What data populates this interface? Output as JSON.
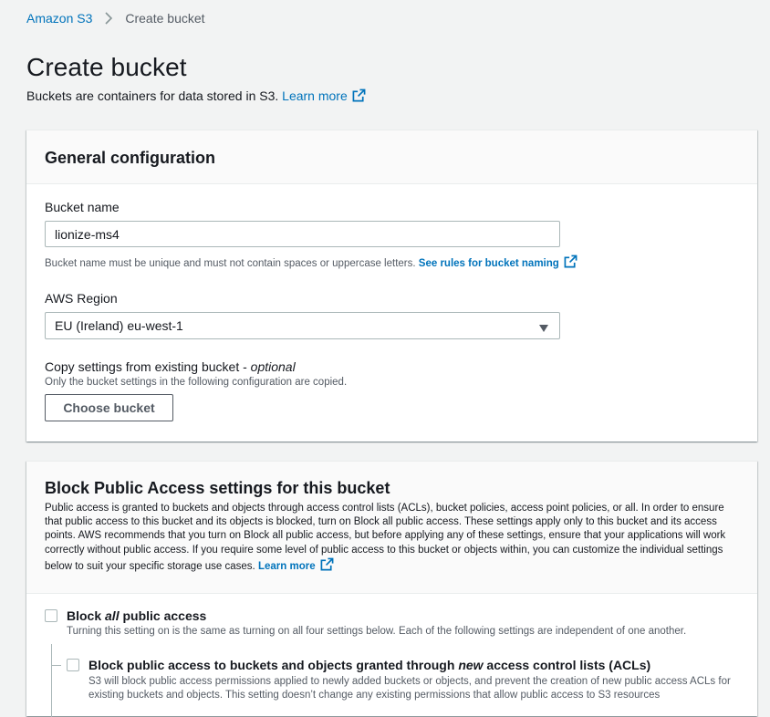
{
  "breadcrumb": {
    "root": "Amazon S3",
    "current": "Create bucket"
  },
  "header": {
    "title": "Create bucket",
    "description": "Buckets are containers for data stored in S3.",
    "learn_more": "Learn more"
  },
  "general": {
    "title": "General configuration",
    "bucket_name_label": "Bucket name",
    "bucket_name_value": "lionize-ms4",
    "bucket_name_hint": "Bucket name must be unique and must not contain spaces or uppercase letters.",
    "bucket_name_rules_link": "See rules for bucket naming",
    "region_label": "AWS Region",
    "region_value": "EU (Ireland) eu-west-1",
    "copy_label": "Copy settings from existing bucket - ",
    "copy_optional": "optional",
    "copy_hint": "Only the bucket settings in the following configuration are copied.",
    "choose_bucket_button": "Choose bucket"
  },
  "block_public": {
    "title": "Block Public Access settings for this bucket",
    "description": "Public access is granted to buckets and objects through access control lists (ACLs), bucket policies, access point policies, or all. In order to ensure that public access to this bucket and its objects is blocked, turn on Block all public access. These settings apply only to this bucket and its access points. AWS recommends that you turn on Block all public access, but before applying any of these settings, ensure that your applications will work correctly without public access. If you require some level of public access to this bucket or objects within, you can customize the individual settings below to suit your specific storage use cases.",
    "learn_more": "Learn more",
    "block_all": {
      "label_pre": "Block ",
      "label_em": "all",
      "label_post": " public access",
      "desc": "Turning this setting on is the same as turning on all four settings below. Each of the following settings are independent of one another."
    },
    "block_new_acl": {
      "label_pre": "Block public access to buckets and objects granted through ",
      "label_em": "new",
      "label_post": " access control lists (ACLs)",
      "desc": "S3 will block public access permissions applied to newly added buckets or objects, and prevent the creation of new public access ACLs for existing buckets and objects. This setting doesn’t change any existing permissions that allow public access to S3 resources"
    }
  },
  "colors": {
    "link": "#0073bb",
    "text": "#16191f",
    "muted": "#545b64",
    "background": "#f2f3f3",
    "border": "#aab7b8"
  }
}
